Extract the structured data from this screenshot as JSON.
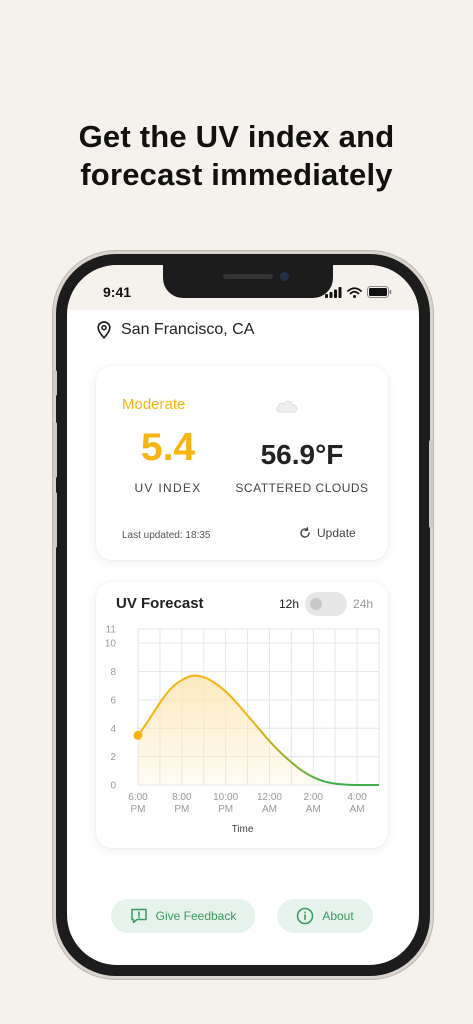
{
  "headline": {
    "line1": "Get the UV index and",
    "line2": "forecast immediately"
  },
  "status_bar": {
    "time": "9:41"
  },
  "location": {
    "icon": "map-pin-icon",
    "text": "San Francisco, CA"
  },
  "current": {
    "uv_level": "Moderate",
    "uv_value": "5.4",
    "uv_label": "UV INDEX",
    "temperature": "56.9°F",
    "weather": "SCATTERED CLOUDS",
    "weather_icon": "cloud-icon",
    "last_updated": "Last updated: 18:35",
    "update_label": "Update"
  },
  "forecast": {
    "title": "UV Forecast",
    "toggle": {
      "left_label": "12h",
      "right_label": "24h",
      "selected": "12h"
    }
  },
  "chart_data": {
    "type": "area",
    "title": "",
    "xlabel": "Time",
    "ylabel": "",
    "y_ticks": [
      "0",
      "2",
      "4",
      "6",
      "8",
      "10",
      "11"
    ],
    "x_ticks": [
      {
        "top": "6:00",
        "bottom": "PM"
      },
      {
        "top": "8:00",
        "bottom": "PM"
      },
      {
        "top": "10:00",
        "bottom": "PM"
      },
      {
        "top": "12:00",
        "bottom": "AM"
      },
      {
        "top": "2:00",
        "bottom": "AM"
      },
      {
        "top": "4:00",
        "bottom": "AM"
      }
    ],
    "ylim": [
      0,
      11
    ],
    "xlim_hours": [
      0,
      11
    ],
    "grid": true,
    "series": [
      {
        "x_hours": [
          0,
          0.5,
          1,
          1.5,
          2,
          2.5,
          3,
          3.5,
          4,
          4.5,
          5,
          5.5,
          6,
          6.5,
          7,
          7.5,
          8,
          8.5,
          9,
          9.5,
          10,
          10.5,
          11
        ],
        "values": [
          3.5,
          4.6,
          5.8,
          6.8,
          7.4,
          7.7,
          7.6,
          7.2,
          6.6,
          5.8,
          4.9,
          4.0,
          3.1,
          2.3,
          1.6,
          1.0,
          0.55,
          0.25,
          0.1,
          0.03,
          0.0,
          0.0,
          0.0
        ]
      }
    ],
    "colors": {
      "start": "#f5b40f",
      "end": "#3fae49",
      "fill": "#fce8b8"
    }
  },
  "buttons": {
    "feedback": {
      "label": "Give Feedback",
      "icon": "message-alert-icon"
    },
    "about": {
      "label": "About",
      "icon": "info-icon"
    }
  }
}
